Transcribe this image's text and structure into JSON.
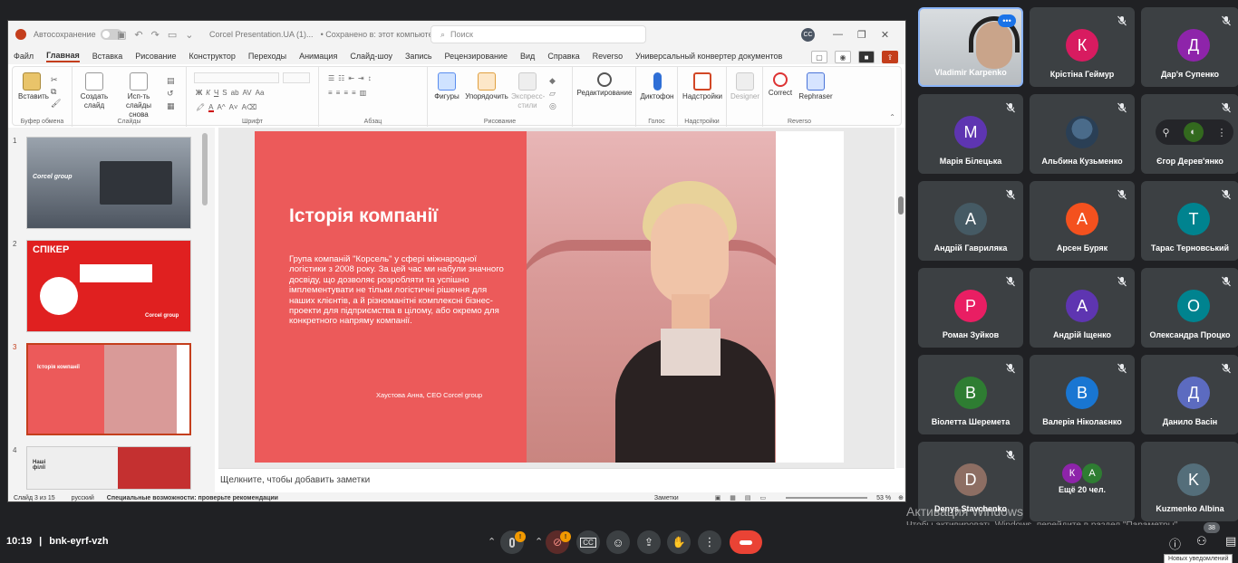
{
  "ppt": {
    "autosave_label": "Автосохранение",
    "file_title": "Corcel Presentation.UA (1)...",
    "saved_status": "• Сохранено в: этот компьютер ▾",
    "search_placeholder": "Поиск",
    "user_initials": "CC",
    "menu": [
      "Файл",
      "Главная",
      "Вставка",
      "Рисование",
      "Конструктор",
      "Переходы",
      "Анимация",
      "Слайд-шоу",
      "Запись",
      "Рецензирование",
      "Вид",
      "Справка",
      "Reverso",
      "Универсальный конвертер документов"
    ],
    "active_menu_index": 1,
    "ribbon": {
      "paste": "Вставить",
      "clipboard_group": "Буфер обмена",
      "create_slide": "Создать слайд",
      "reuse_slides": "Исп-ть слайды снова",
      "slides_group": "Слайды",
      "font_group": "Шрифт",
      "paragraph_group": "Абзац",
      "shapes": "Фигуры",
      "arrange": "Упорядочить",
      "express_styles": "Экспресс-стили",
      "drawing_group": "Рисование",
      "editing": "Редактирование",
      "dictation": "Диктофон",
      "voice_group": "Голос",
      "addins": "Надстройки",
      "addins_group": "Надстройки",
      "designer": "Designer",
      "correct": "Correct",
      "rephraser": "Rephraser",
      "reverso_group": "Reverso"
    },
    "thumbnails": [
      {
        "num": "1",
        "brand": "Corcel group"
      },
      {
        "num": "2",
        "title": "СПІКЕР",
        "brand": "Corcel group"
      },
      {
        "num": "3",
        "title": "Історія компанії"
      },
      {
        "num": "4",
        "title": "Наші філії"
      }
    ],
    "slide": {
      "title": "Історія компанії",
      "body": "Група компаній \"Корсель\" у сфері міжнародної логістики з 2008 року. За цей час ми набули значного досвіду, що дозволяє розробляти та успішно імплементувати не тільки логістичні рішення для наших клієнтів, а й різноманітні комплексні бізнес-проекти для підприємства в цілому, або окремо для конкретного напряму компанії.",
      "author": "Хаустова Анна, CEO Corcel group"
    },
    "notes_placeholder": "Щелкните, чтобы добавить заметки",
    "status": {
      "slide_of": "Слайд 3 из 15",
      "language": "русский",
      "accessibility": "Специальные возможности: проверьте рекомендации",
      "notes_btn": "Заметки",
      "zoom": "53 %"
    }
  },
  "participants": [
    {
      "name": "Vladimir Karpenko",
      "initial": "",
      "color": "",
      "video": true,
      "muted": false
    },
    {
      "name": "Крістіна Геймур",
      "initial": "К",
      "color": "#d81b60",
      "muted": true
    },
    {
      "name": "Дар'я Супенко",
      "initial": "Д",
      "color": "#8e24aa",
      "muted": true
    },
    {
      "name": "Марія Білецька",
      "initial": "М",
      "color": "#5e35b1",
      "muted": true
    },
    {
      "name": "Альбина Кузьменко",
      "initial": "",
      "color": "#8d6e63",
      "photo": true,
      "muted": true
    },
    {
      "name": "Єгор Дерев'янко",
      "initial": "",
      "color": "#33691e",
      "muted": true
    },
    {
      "name": "Андрій Гавриляка",
      "initial": "А",
      "color": "#455a64",
      "muted": true
    },
    {
      "name": "Арсен Буряк",
      "initial": "А",
      "color": "#f4511e",
      "muted": true
    },
    {
      "name": "Тарас Терновський",
      "initial": "Т",
      "color": "#00838f",
      "muted": true
    },
    {
      "name": "Роман Зуйков",
      "initial": "Р",
      "color": "#e91e63",
      "muted": true
    },
    {
      "name": "Андрій Іщенко",
      "initial": "А",
      "color": "#5e35b1",
      "muted": true
    },
    {
      "name": "Олександра Процко",
      "initial": "О",
      "color": "#00838f",
      "muted": true
    },
    {
      "name": "Віолетта Шеремета",
      "initial": "В",
      "color": "#2e7d32",
      "muted": true
    },
    {
      "name": "Валерія Ніколаєнко",
      "initial": "В",
      "color": "#1976d2",
      "muted": true
    },
    {
      "name": "Данило Васін",
      "initial": "Д",
      "color": "#5c6bc0",
      "muted": true
    },
    {
      "name": "Denys Stavchenko",
      "initial": "D",
      "color": "#8d6e63",
      "muted": true
    },
    {
      "name": "Ещё 20 чел.",
      "initial": "",
      "color": "",
      "group": true,
      "group_initials": [
        "К",
        "А"
      ]
    },
    {
      "name": "Kuzmenko Albina",
      "initial": "K",
      "color": "#546e7a",
      "muted": false
    }
  ],
  "meet": {
    "time": "10:19",
    "separator": "|",
    "meeting_code": "bnk-eyrf-vzh",
    "mic_badge": "!",
    "cam_badge": "!",
    "chat_count": "38",
    "tooltip": "Новых уведомлений"
  },
  "windows_watermark": {
    "line1": "Активация Windows",
    "line2": "Чтобы активировать Windows, перейдите в раздел \"Параметры\"."
  }
}
